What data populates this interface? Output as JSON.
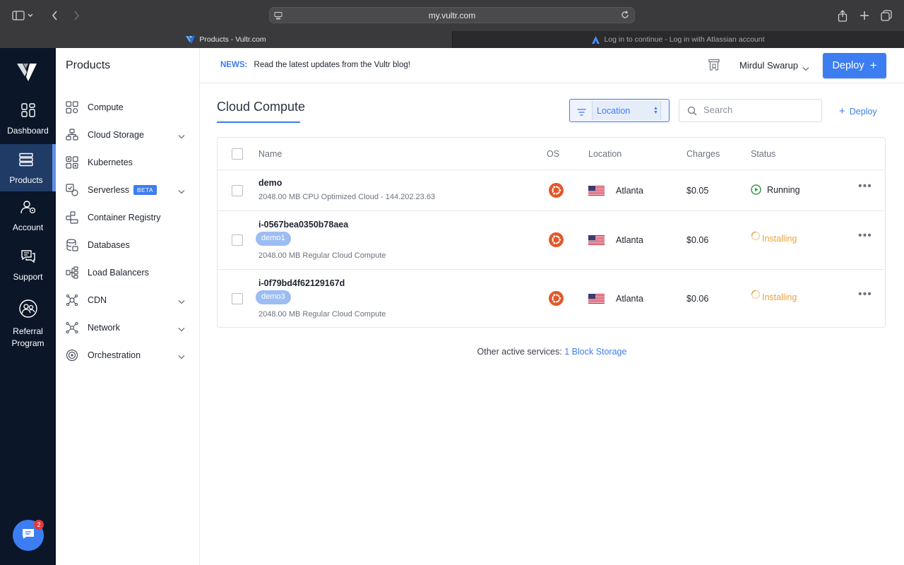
{
  "browser": {
    "url": "my.vultr.com",
    "tabs": [
      {
        "title": "Products - Vultr.com",
        "active": true
      },
      {
        "title": "Log in to continue - Log in with Atlassian account",
        "active": false
      }
    ]
  },
  "rail": {
    "items": [
      {
        "label": "Dashboard",
        "icon": "dashboard-icon"
      },
      {
        "label": "Products",
        "icon": "products-icon",
        "active": true
      },
      {
        "label": "Account",
        "icon": "account-icon"
      },
      {
        "label": "Support",
        "icon": "support-icon"
      },
      {
        "label": "Referral Program",
        "icon": "referral-icon"
      }
    ],
    "chat_badge": "2"
  },
  "sidebar": {
    "title": "Products",
    "items": [
      {
        "label": "Compute",
        "icon": "compute-icon",
        "has_chevron": false
      },
      {
        "label": "Cloud Storage",
        "icon": "cloud-storage-icon",
        "has_chevron": true
      },
      {
        "label": "Kubernetes",
        "icon": "kubernetes-icon",
        "has_chevron": false
      },
      {
        "label": "Serverless",
        "icon": "serverless-icon",
        "has_chevron": true,
        "badge": "BETA"
      },
      {
        "label": "Container Registry",
        "icon": "container-registry-icon",
        "has_chevron": false
      },
      {
        "label": "Databases",
        "icon": "databases-icon",
        "has_chevron": false
      },
      {
        "label": "Load Balancers",
        "icon": "load-balancers-icon",
        "has_chevron": false
      },
      {
        "label": "CDN",
        "icon": "cdn-icon",
        "has_chevron": true
      },
      {
        "label": "Network",
        "icon": "network-icon",
        "has_chevron": true
      },
      {
        "label": "Orchestration",
        "icon": "orchestration-icon",
        "has_chevron": true
      }
    ]
  },
  "topbar": {
    "news_tag": "NEWS:",
    "news_text": "Read the latest updates from the Vultr blog!",
    "user_name": "Mirdul Swarup",
    "deploy_label": "Deploy",
    "deploy_plus": "+"
  },
  "main": {
    "title": "Cloud Compute",
    "filter_value": "Location",
    "search_placeholder": "Search",
    "deploy_link": "Deploy",
    "deploy_link_plus": "+",
    "columns": [
      "Name",
      "OS",
      "Location",
      "Charges",
      "Status"
    ],
    "rows": [
      {
        "name": "demo",
        "tag": "",
        "description": "2048.00 MB CPU Optimized Cloud - 144.202.23.63",
        "os": "ubuntu-icon",
        "location": "Atlanta",
        "charges": "$0.05",
        "status": "Running"
      },
      {
        "name": "i-0567bea0350b78aea",
        "tag": "demo1",
        "description": "2048.00 MB Regular Cloud Compute",
        "os": "ubuntu-icon",
        "location": "Atlanta",
        "charges": "$0.06",
        "status": "Installing"
      },
      {
        "name": "i-0f79bd4f62129167d",
        "tag": "demo3",
        "description": "2048.00 MB Regular Cloud Compute",
        "os": "ubuntu-icon",
        "location": "Atlanta",
        "charges": "$0.06",
        "status": "Installing"
      }
    ],
    "more_label": "•••",
    "other_prefix": "Other active services:",
    "other_link": "1 Block Storage"
  },
  "colors": {
    "accent": "#3d7df2",
    "rail_bg": "#0b1629",
    "installing": "#e8a33d",
    "running": "#3a9a4a",
    "ubuntu": "#e05a2a"
  }
}
